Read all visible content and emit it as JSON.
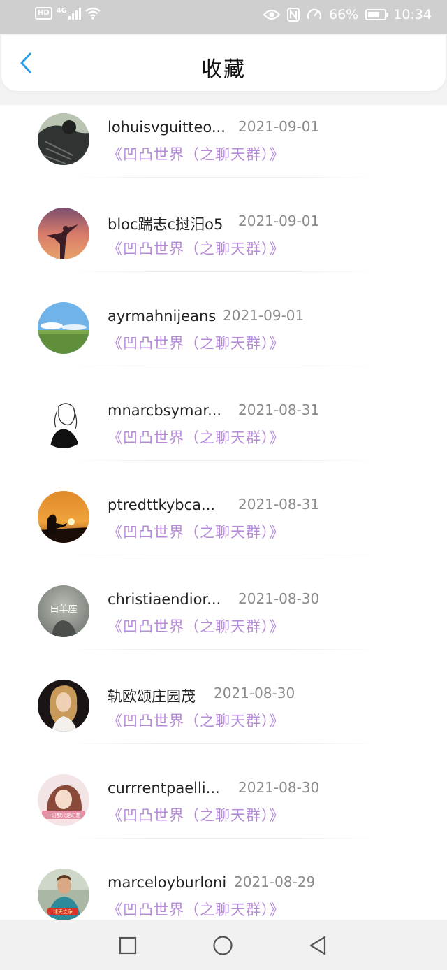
{
  "status_bar": {
    "network_badge": "HD",
    "network_type": "4G",
    "battery_percent": "66%",
    "time": "10:34",
    "icons": [
      "hd-icon",
      "signal-icon",
      "wifi-icon",
      "eye-icon",
      "nfc-icon",
      "speed-icon",
      "battery-icon"
    ]
  },
  "header": {
    "title": "收藏",
    "back_icon": "chevron-left-icon",
    "accent_color": "#2a9fe8"
  },
  "colors": {
    "group_text": "#b58bd8",
    "date_text": "#8a8a8a",
    "name_text": "#222222"
  },
  "items": [
    {
      "name": "lohuisvguitteo...",
      "date": "2021-09-01",
      "group": "《凹凸世界（之聊天群）》",
      "avatar": "avatar-sweater-photo"
    },
    {
      "name": "bloc踹志c挝汨o5",
      "date": "2021-09-01",
      "group": "《凹凸世界（之聊天群）》",
      "avatar": "avatar-sunset-silhouette"
    },
    {
      "name": "ayrmahnijeans",
      "date": "2021-09-01",
      "group": "《凹凸世界（之聊天群）》",
      "avatar": "avatar-grassland-sky"
    },
    {
      "name": "mnarcbsymar...",
      "date": "2021-08-31",
      "group": "《凹凸世界（之聊天群）》",
      "avatar": "avatar-sketch-girl"
    },
    {
      "name": "ptredttkybca...",
      "date": "2021-08-31",
      "group": "《凹凸世界（之聊天群）》",
      "avatar": "avatar-orange-sunset"
    },
    {
      "name": "christiaendior...",
      "date": "2021-08-30",
      "group": "《凹凸世界（之聊天群）》",
      "avatar": "avatar-aries-text",
      "avatar_text": "白羊座"
    },
    {
      "name": "轨欧颂庄园茂",
      "date": "2021-08-30",
      "group": "《凹凸世界（之聊天群）》",
      "avatar": "avatar-blonde-woman"
    },
    {
      "name": "currrentpaelli...",
      "date": "2021-08-30",
      "group": "《凹凸世界（之聊天群）》",
      "avatar": "avatar-anime-girl",
      "avatar_text": "一切都只是幻想"
    },
    {
      "name": "marceloyburloni",
      "date": "2021-08-29",
      "group": "《凹凸世界（之聊天群）》",
      "avatar": "avatar-boy-photo",
      "avatar_text": "球天之争"
    }
  ],
  "nav": {
    "recent_icon": "square-icon",
    "home_icon": "circle-icon",
    "back_icon": "triangle-back-icon"
  }
}
